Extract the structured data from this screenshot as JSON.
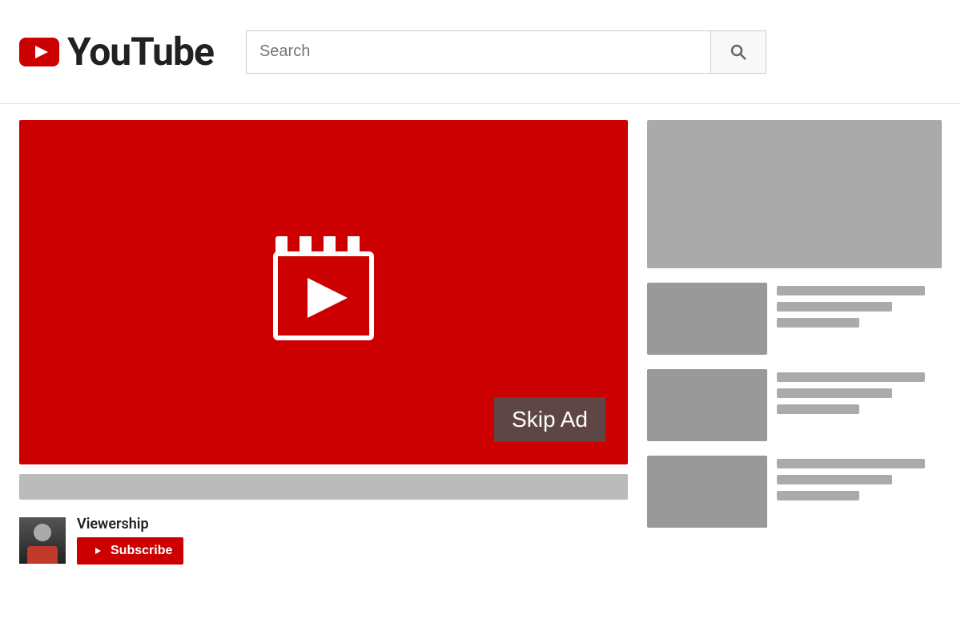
{
  "header": {
    "logo_text": "YouTube",
    "search_placeholder": "Search",
    "search_btn_label": "Search"
  },
  "video": {
    "skip_ad_label": "Skip Ad"
  },
  "channel": {
    "name": "Viewership",
    "subscribe_label": "Subscribe"
  },
  "sidebar": {
    "items": [
      {
        "id": 1
      },
      {
        "id": 2
      },
      {
        "id": 3
      }
    ]
  }
}
